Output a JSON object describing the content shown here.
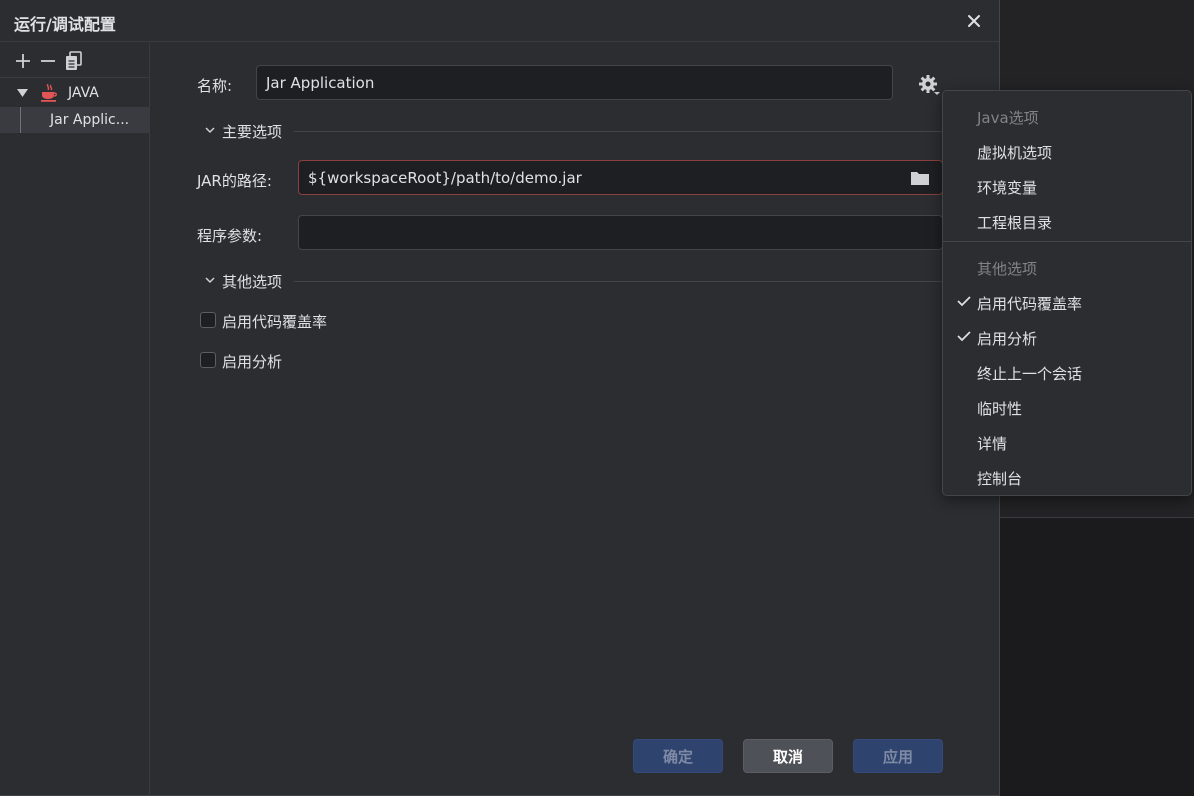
{
  "dialog": {
    "title": "运行/调试配置"
  },
  "sidebar": {
    "tree": [
      {
        "label": "JAVA"
      },
      {
        "label": "Jar Applic..."
      }
    ]
  },
  "form": {
    "name_label": "名称:",
    "name_value": "Jar Application",
    "main_section": "主要选项",
    "jar_label": "JAR的路径:",
    "jar_value": "${workspaceRoot}/path/to/demo.jar",
    "args_label": "程序参数:",
    "args_value": "",
    "other_section": "其他选项",
    "coverage_label": "启用代码覆盖率",
    "coverage_checked": false,
    "profile_label": "启用分析",
    "profile_checked": false
  },
  "buttons": {
    "ok": "确定",
    "cancel": "取消",
    "apply": "应用"
  },
  "menu": {
    "java_header": "Java选项",
    "java_items": [
      "虚拟机选项",
      "环境变量",
      "工程根目录"
    ],
    "other_header": "其他选项",
    "other_items": [
      {
        "label": "启用代码覆盖率",
        "checked": true
      },
      {
        "label": "启用分析",
        "checked": true
      },
      {
        "label": "终止上一个会话",
        "checked": false
      },
      {
        "label": "临时性",
        "checked": false
      },
      {
        "label": "详情",
        "checked": false
      },
      {
        "label": "控制台",
        "checked": false
      }
    ]
  },
  "colors": {
    "background": "#2b2d30",
    "input_bg": "#1e1f22",
    "primary_button": "#2e436e",
    "error_border": "#8a4040"
  }
}
